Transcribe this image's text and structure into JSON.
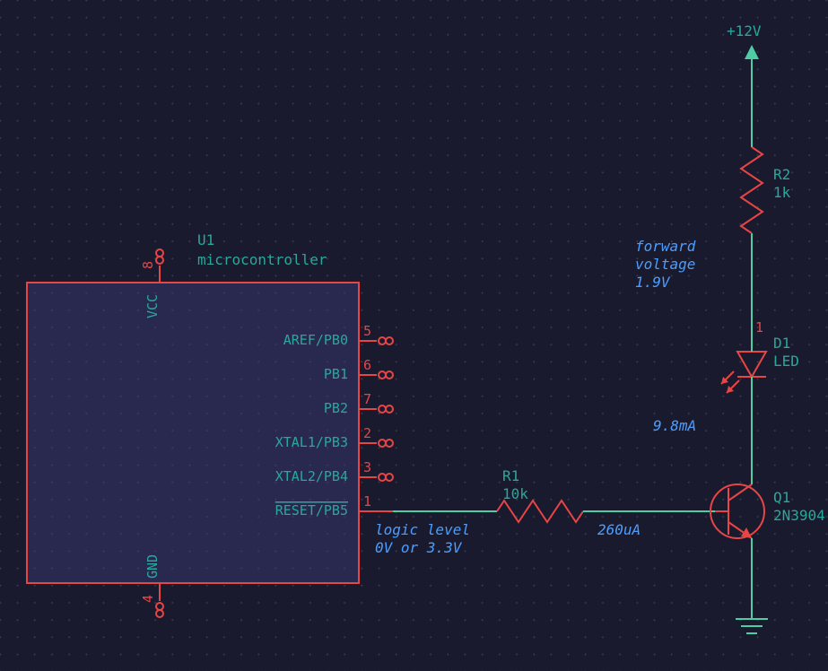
{
  "power": {
    "label": "+12V"
  },
  "u1": {
    "ref": "U1",
    "name": "microcontroller",
    "vcc": "VCC",
    "gnd": "GND",
    "pins_right": [
      {
        "name": "AREF/PB0",
        "num": "5"
      },
      {
        "name": "PB1",
        "num": "6"
      },
      {
        "name": "PB2",
        "num": "7"
      },
      {
        "name": "XTAL1/PB3",
        "num": "2"
      },
      {
        "name": "XTAL2/PB4",
        "num": "3"
      },
      {
        "name": "RESET/PB5",
        "num": "1",
        "overline": true
      }
    ],
    "pin_vcc": "8",
    "pin_gnd": "4"
  },
  "r1": {
    "ref": "R1",
    "value": "10k"
  },
  "r2": {
    "ref": "R2",
    "value": "1k"
  },
  "d1": {
    "ref": "D1",
    "value": "LED",
    "pin1": "1"
  },
  "q1": {
    "ref": "Q1",
    "value": "2N3904"
  },
  "notes": {
    "fwd1": "forward",
    "fwd2": "voltage",
    "fwd3": "1.9V",
    "iled": "9.8mA",
    "ibase": "260uA",
    "logic1": "logic level",
    "logic2": "0V or 3.3V"
  }
}
